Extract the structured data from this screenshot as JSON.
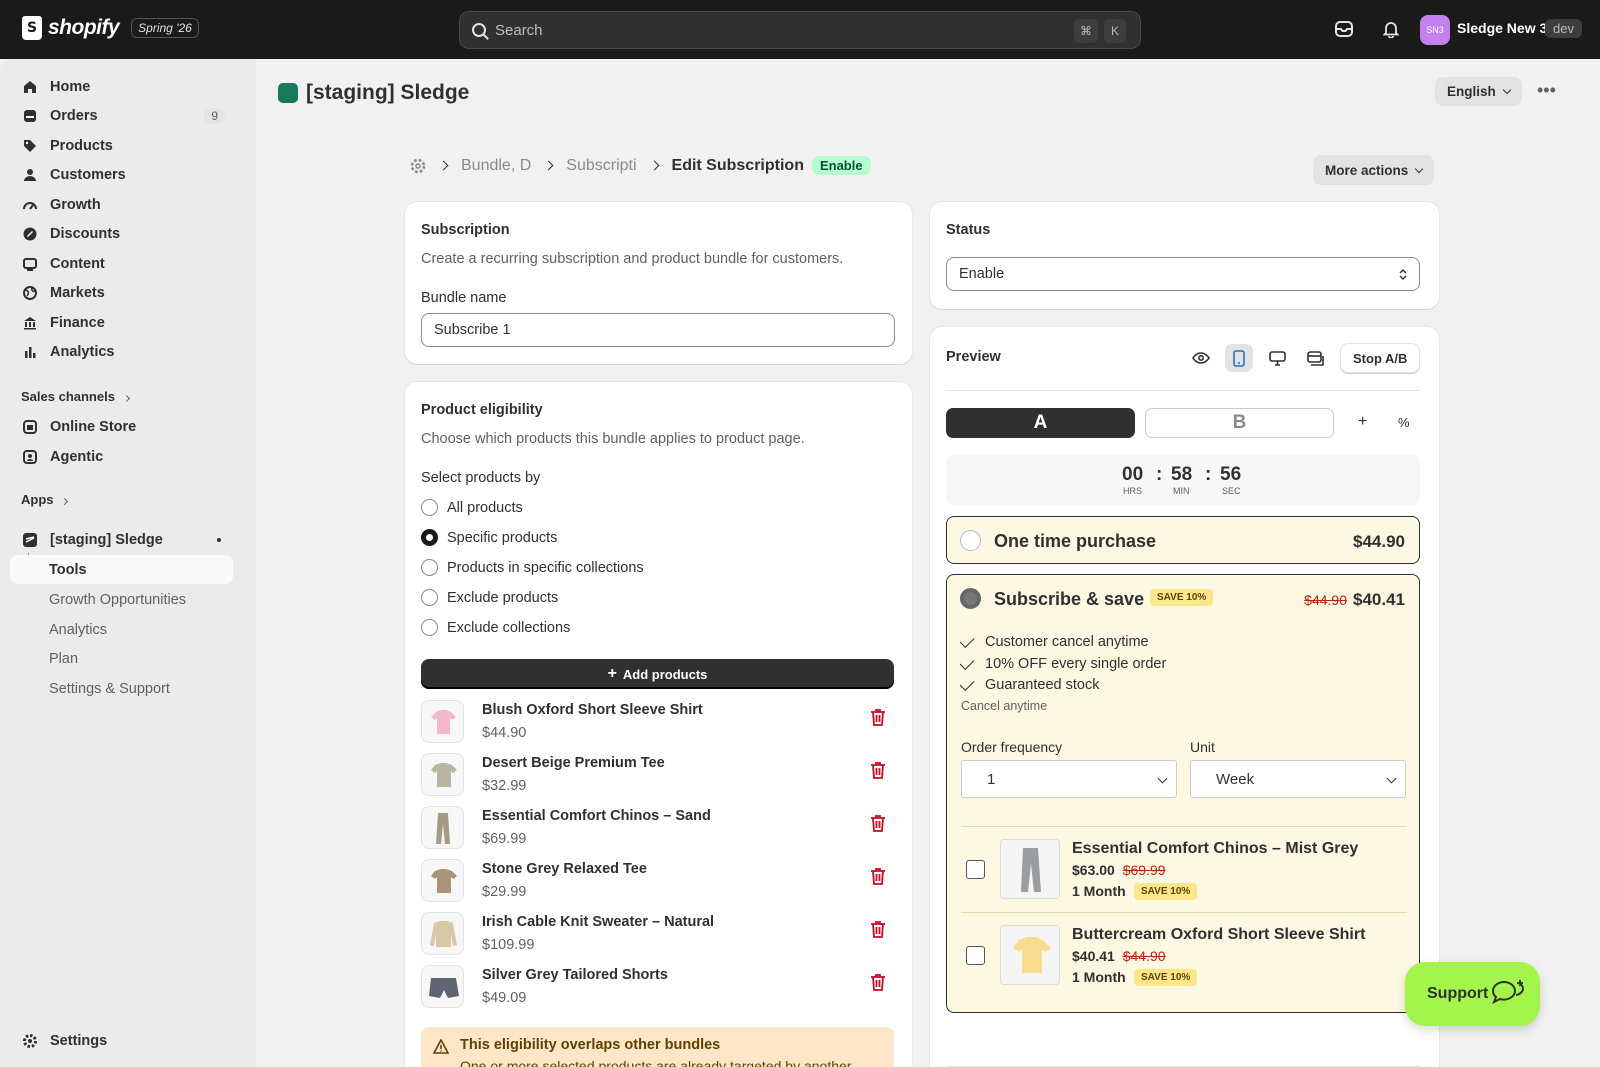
{
  "topbar": {
    "brand": "shopify",
    "release": "Spring '26",
    "search_placeholder": "Search",
    "shortcut_keys": [
      "⌘",
      "K"
    ],
    "store_initials": "SN3",
    "store_name": "Sledge New 3",
    "env_badge": "dev"
  },
  "sidebar": {
    "items": [
      {
        "label": "Home",
        "icon": "home-icon"
      },
      {
        "label": "Orders",
        "icon": "orders-icon",
        "count": "9"
      },
      {
        "label": "Products",
        "icon": "tag-icon"
      },
      {
        "label": "Customers",
        "icon": "person-icon"
      },
      {
        "label": "Growth",
        "icon": "gauge-icon"
      },
      {
        "label": "Discounts",
        "icon": "discount-icon"
      },
      {
        "label": "Content",
        "icon": "content-icon"
      },
      {
        "label": "Markets",
        "icon": "globe-icon"
      },
      {
        "label": "Finance",
        "icon": "bank-icon"
      },
      {
        "label": "Analytics",
        "icon": "bar-chart-icon"
      }
    ],
    "sales_channels_label": "Sales channels",
    "channels": [
      {
        "label": "Online Store",
        "icon": "store-icon"
      },
      {
        "label": "Agentic",
        "icon": "agentic-icon"
      }
    ],
    "apps_label": "Apps",
    "app_name": "[staging] Sledge",
    "app_subitems": [
      "Tools",
      "Growth Opportunities",
      "Analytics",
      "Plan",
      "Settings & Support"
    ],
    "settings_label": "Settings"
  },
  "header": {
    "app_title": "[staging] Sledge",
    "language": "English"
  },
  "breadcrumb": {
    "crumbs": [
      "Bundle, D",
      "Subscripti"
    ],
    "current": "Edit Subscription",
    "status_badge": "Enable",
    "more_actions": "More actions"
  },
  "subscription_card": {
    "title": "Subscription",
    "description": "Create a recurring subscription and product bundle for customers.",
    "bundle_name_label": "Bundle name",
    "bundle_name_value": "Subscribe 1"
  },
  "eligibility_card": {
    "title": "Product eligibility",
    "description": "Choose which products this bundle applies to product page.",
    "select_by_label": "Select products by",
    "options": [
      "All products",
      "Specific products",
      "Products in specific collections",
      "Exclude products",
      "Exclude collections"
    ],
    "selected_option": "Specific products",
    "add_products_label": "Add products",
    "products": [
      {
        "name": "Blush Oxford Short Sleeve Shirt",
        "price": "$44.90",
        "color": "#f4b8cc"
      },
      {
        "name": "Desert Beige Premium Tee",
        "price": "$32.99",
        "color": "#b9b59f"
      },
      {
        "name": "Essential Comfort Chinos – Sand",
        "price": "$69.99",
        "color": "#a69a82"
      },
      {
        "name": "Stone Grey Relaxed Tee",
        "price": "$29.99",
        "color": "#a89478"
      },
      {
        "name": "Irish Cable Knit Sweater – Natural",
        "price": "$109.99",
        "color": "#d8c8a8"
      },
      {
        "name": "Silver Grey Tailored Shorts",
        "price": "$49.09",
        "color": "#5e6570"
      }
    ],
    "warning_title": "This eligibility overlaps other bundles",
    "warning_body": "One or more selected products are already targeted by another"
  },
  "status_card": {
    "title": "Status",
    "value": "Enable"
  },
  "preview_card": {
    "title": "Preview",
    "stop_ab_label": "Stop A/B",
    "variant_a": "A",
    "variant_b": "B",
    "add_variant": "+",
    "split_symbol": "%",
    "timer": {
      "hours": "00",
      "minutes": "58",
      "seconds": "56",
      "hrs_label": "HRS",
      "min_label": "MIN",
      "sec_label": "SEC"
    },
    "one_time": {
      "title": "One time purchase",
      "price": "$44.90"
    },
    "subscribe": {
      "title": "Subscribe & save",
      "badge": "SAVE 10%",
      "old_price": "$44.90",
      "price": "$40.41",
      "benefits": [
        "Customer cancel anytime",
        "10% OFF every single order",
        "Guaranteed stock"
      ],
      "note": "Cancel anytime",
      "frequency_label": "Order frequency",
      "frequency_value": "1",
      "unit_label": "Unit",
      "unit_value": "Week"
    },
    "upsells": [
      {
        "name": "Essential Comfort Chinos – Mist Grey",
        "price": "$63.00",
        "old_price": "$69.99",
        "term": "1 Month",
        "badge": "SAVE 10%",
        "color": "#9a9ea3"
      },
      {
        "name": "Buttercream Oxford Short Sleeve Shirt",
        "price": "$40.41",
        "old_price": "$44.90",
        "term": "1 Month",
        "badge": "SAVE 10%",
        "color": "#f6dc8f"
      }
    ]
  },
  "support_label": "Support"
}
